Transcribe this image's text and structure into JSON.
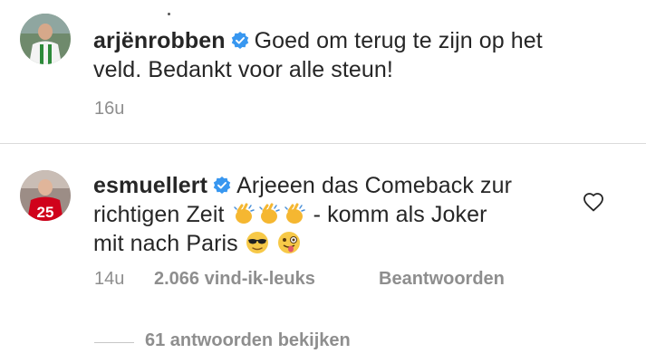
{
  "comments": [
    {
      "username": "arjënrobben",
      "text": "Goed om terug te zijn op het veld. Bedankt voor alle steun!",
      "text_line1": "Goed om terug te zijn op het",
      "text_line2": "veld. Bedankt voor alle steun!",
      "timestamp": "16u",
      "verified": true
    },
    {
      "username": "esmuellert",
      "text_line1": "Arjeeen das Comeback zur",
      "text_line2_pre": "richtigen Zeit",
      "text_line2_post": "- komm als Joker",
      "text_line3": "mit nach Paris",
      "emojis_line2": [
        "clapping-hands",
        "clapping-hands",
        "clapping-hands"
      ],
      "emojis_line3": [
        "sunglasses-face",
        "winking-tongue-face"
      ],
      "timestamp": "14u",
      "likes": "2.066 vind-ik-leuks",
      "reply_label": "Beantwoorden",
      "verified": true,
      "avatar_number": "25"
    }
  ],
  "view_replies_label": "61 antwoorden bekijken",
  "colors": {
    "verified_blue": "#3897f0",
    "meta_gray": "#8e8e8e",
    "text_dark": "#262626"
  }
}
